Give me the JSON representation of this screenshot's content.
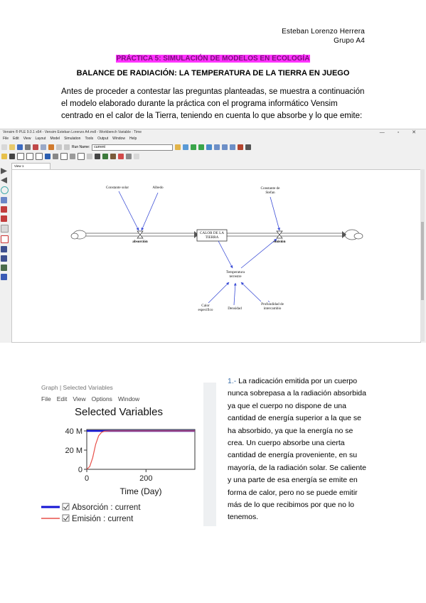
{
  "header": {
    "author_name": "Esteban Lorenzo Herrera",
    "group": "Grupo A4"
  },
  "title": "PRÁCTICA 5: SIMULACIÓN DE MODELOS EN ECOLOGÍA",
  "subtitle": "BALANCE DE RADIACIÓN: LA TEMPERATURA DE LA TIERRA EN JUEGO",
  "intro_text": "Antes de proceder a contestar las preguntas planteadas, se muestra a continuación el modelo elaborado durante la práctica con el programa informático Vensim centrado en el calor de la Tierra, teniendo en cuenta lo que absorbe y lo que emite:",
  "vensim": {
    "window_title": "Vensim ® PLE 9.0.1 x64 - Vensim Esteban Lorenzo A4.mdl - Workbench Variable : Time",
    "menu": [
      "File",
      "Edit",
      "View",
      "Layout",
      "Model",
      "Simulation",
      "Tools",
      "Output",
      "Window",
      "Help"
    ],
    "run_name_label": "Run Name:",
    "run_name_value": "current",
    "view_tab": "View 1",
    "window_controls": "— ▫ ✕",
    "diagram": {
      "constante_solar": "Constante solar",
      "albedo": "Albedo",
      "constante_stefan": [
        "Constante de",
        "Stefan"
      ],
      "calor_tierra": [
        "CALOR DE LA",
        "TIERRA"
      ],
      "absorcion": "absorción",
      "emision": "emisión",
      "temperatura": [
        "Temperatura",
        "terrestre"
      ],
      "calor_especifico": [
        "Calor",
        "específico"
      ],
      "densidad": "Densidad",
      "profundidad": [
        "Profundidad de",
        "intercambio"
      ]
    }
  },
  "graph": {
    "window_title": "Graph | Selected Variables",
    "menu": [
      "File",
      "Edit",
      "View",
      "Options",
      "Window"
    ]
  },
  "chart_data": {
    "type": "line",
    "title": "Selected Variables",
    "xlabel": "Time (Day)",
    "ylabel": "",
    "x_ticks": [
      "0",
      "200"
    ],
    "y_ticks": [
      "0",
      "20 M",
      "40 M"
    ],
    "xlim": [
      0,
      365
    ],
    "ylim": [
      0,
      40000000
    ],
    "series": [
      {
        "name": "Absorción : current",
        "color": "#1414d4",
        "x": [
          0,
          365
        ],
        "y": [
          40000000,
          40000000
        ]
      },
      {
        "name": "Emisión : current",
        "color": "#e8504a",
        "x": [
          0,
          10,
          20,
          30,
          40,
          50,
          60,
          80,
          365
        ],
        "y": [
          0,
          3000000,
          12000000,
          26000000,
          35000000,
          38500000,
          39700000,
          40000000,
          40000000
        ]
      }
    ]
  },
  "answer": {
    "number": "1.-",
    "text": " La radicación emitida por un cuerpo nunca sobrepasa a la radiación absorbida ya que el cuerpo no dispone de una cantidad de energía superior a la que se ha absorbido, ya que la energía no se crea. Un cuerpo absorbe una cierta cantidad de energía proveniente, en su mayoría, de la radiación solar. Se caliente y una parte de esa energía se emite en forma de calor, pero no se puede emitir más de lo que recibimos por que no lo tenemos."
  },
  "colors": {
    "highlight": "#ff33ff",
    "highlight_text": "#7a0d7a",
    "arrow": "#3b4dd6",
    "answer_number": "#3a6ea8"
  }
}
